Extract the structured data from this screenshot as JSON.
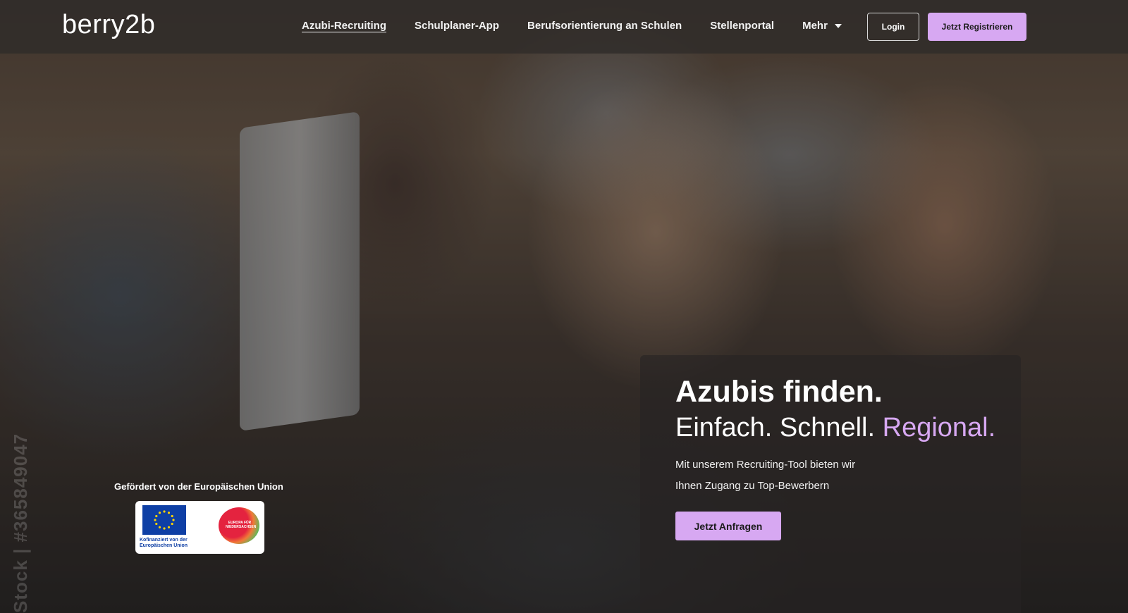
{
  "brand": {
    "logo_text": "berry2b"
  },
  "nav": {
    "links": [
      {
        "label": "Azubi-Recruiting",
        "active": true
      },
      {
        "label": "Schulplaner-App"
      },
      {
        "label": "Berufsorientierung an Schulen"
      },
      {
        "label": "Stellenportal"
      }
    ],
    "more_label": "Mehr",
    "more_icon": "chevron-down-icon",
    "login_label": "Login",
    "register_label": "Jetzt Registrieren"
  },
  "hero": {
    "title": "Azubis finden.",
    "subtitle_plain": "Einfach. Schnell.",
    "subtitle_accent": "Regional.",
    "description_line1": "Mit unserem Recruiting-Tool bieten wir",
    "description_line2": "Ihnen Zugang zu Top-Bewerbern",
    "cta_label": "Jetzt Anfragen"
  },
  "funding": {
    "caption": "Gefördert von der Europäischen Union",
    "eu_logo_text": "Kofinanziert von der Europäischen Union",
    "nds_logo_text": "EUROPA FÜR NIEDERSACHSEN"
  },
  "watermark_text": "Stock | #365849047",
  "colors": {
    "accent": "#d7a8f2",
    "navbar_bg": "#302c2a",
    "eu_blue": "#0e3fa5",
    "text": "#ffffff"
  }
}
